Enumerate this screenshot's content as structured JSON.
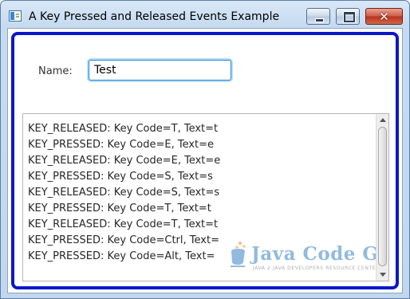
{
  "window": {
    "title": "A Key Pressed and Released Events Example",
    "close_glyph": "✕"
  },
  "form": {
    "name_label": "Name:",
    "name_value": "Test"
  },
  "log": {
    "lines": [
      "KEY_RELEASED: Key Code=T, Text=t",
      "KEY_PRESSED: Key Code=E, Text=e",
      "KEY_RELEASED: Key Code=E, Text=e",
      "KEY_PRESSED: Key Code=S, Text=s",
      "KEY_RELEASED: Key Code=S, Text=s",
      "KEY_PRESSED: Key Code=T, Text=t",
      "KEY_RELEASED: Key Code=T, Text=t",
      "KEY_PRESSED: Key Code=Ctrl, Text=",
      "KEY_PRESSED: Key Code=Alt, Text="
    ]
  },
  "watermark": {
    "title": "Java Code Geeks",
    "subtitle": "JAVA 2 JAVA DEVELOPERS RESOURCE CENTER"
  },
  "colors": {
    "pane_border": "#0a17c9",
    "input_focus": "#1f87d6",
    "close_button": "#c6432c"
  },
  "icons": {
    "app": "java-app-icon",
    "minimize": "minimize-icon",
    "maximize": "maximize-icon",
    "close": "close-icon"
  }
}
